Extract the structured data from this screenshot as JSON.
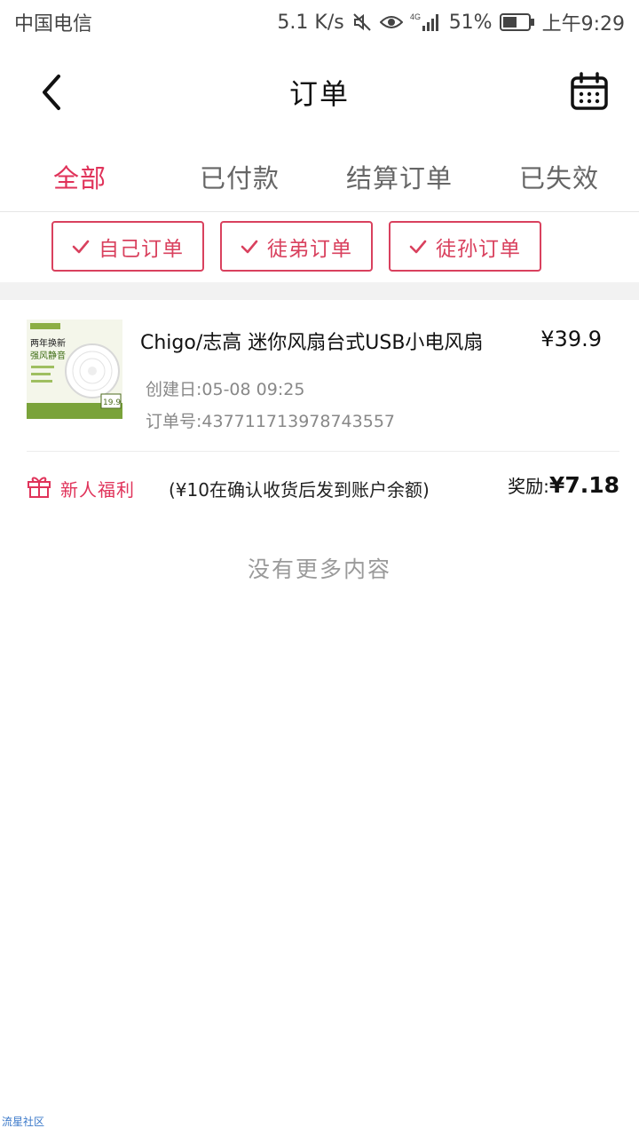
{
  "status_bar": {
    "carrier": "中国电信",
    "speed": "5.1 K/s",
    "network": "4G",
    "battery": "51%",
    "time": "上午9:29"
  },
  "header": {
    "title": "订单",
    "back_icon": "chevron-left-icon",
    "calendar_icon": "calendar-icon"
  },
  "tabs": [
    {
      "label": "全部",
      "active": true
    },
    {
      "label": "已付款",
      "active": false
    },
    {
      "label": "结算订单",
      "active": false
    },
    {
      "label": "已失效",
      "active": false
    }
  ],
  "filters": [
    {
      "label": "自己订单",
      "checked": true
    },
    {
      "label": "徒弟订单",
      "checked": true
    },
    {
      "label": "徒孙订单",
      "checked": true
    }
  ],
  "order": {
    "title": "Chigo/志高  迷你风扇台式USB小电风扇",
    "price": "¥39.9",
    "created": "创建日:05-08  09:25",
    "order_no": "订单号:4377117139787435 57",
    "thumb": {
      "badge": "两年换新",
      "tagline": "强风静音",
      "price_tag": "19.9"
    }
  },
  "reward": {
    "label": "新人福利",
    "note": "(¥10在确认收货后发到账户余额)",
    "prefix": "奖励:",
    "amount": "¥7.18"
  },
  "footer": {
    "no_more": "没有更多内容",
    "watermark": "流星社区"
  },
  "colors": {
    "accent": "#e0335a",
    "filter_border": "#d9415e",
    "text_gray": "#888888"
  }
}
